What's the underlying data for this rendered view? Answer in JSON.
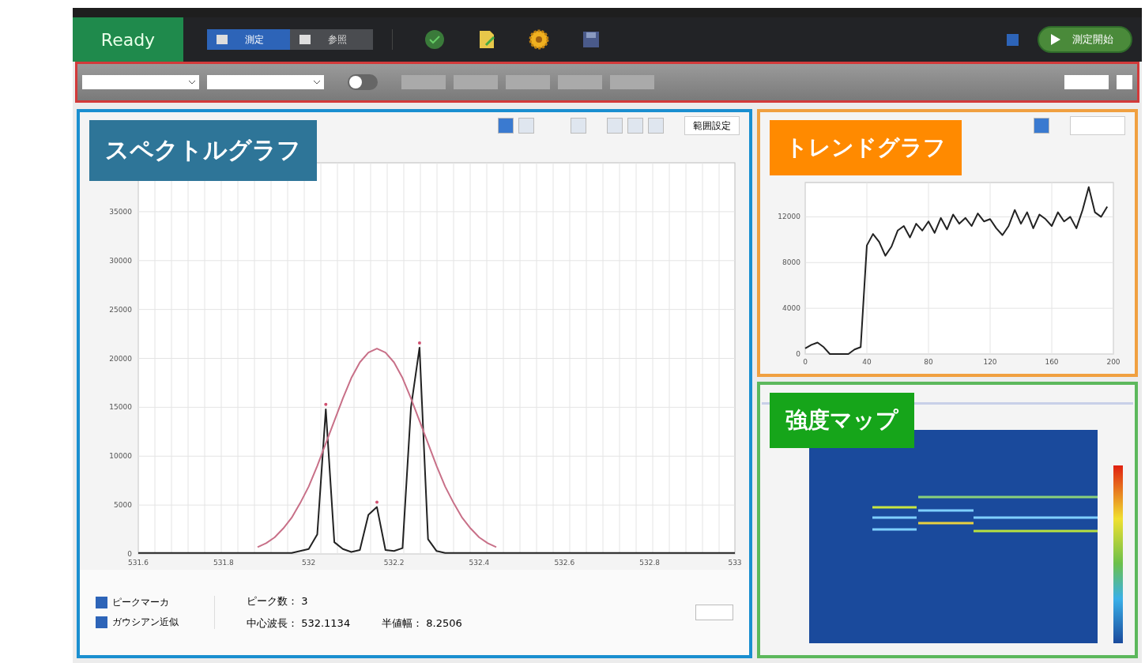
{
  "status": "Ready",
  "mode_tabs": [
    {
      "label": "測定",
      "selected": true
    },
    {
      "label": "参照",
      "selected": false
    }
  ],
  "auto_save": {
    "checked": true
  },
  "start_button": "測定開始",
  "display_toggle": {
    "on": false
  },
  "overlays": [
    {
      "label": "スペクトルグラフ",
      "color": "#2e7598"
    },
    {
      "label": "トレンドグラフ",
      "color": "#ff8a00"
    },
    {
      "label": "強度マップ",
      "color": "#16a51a"
    }
  ],
  "spectrum": {
    "range_button": "範囲設定",
    "chart_data": {
      "type": "line",
      "grid": true,
      "xlim": [
        531.6,
        533
      ],
      "ylim": [
        0,
        40000
      ],
      "xticks": [
        531.6,
        531.8,
        532,
        532.2,
        532.4,
        532.6,
        532.8,
        533
      ],
      "yticks": [
        35000,
        30000,
        25000,
        20000,
        15000,
        10000,
        5000,
        0
      ],
      "x": [
        531.6,
        531.62,
        531.64,
        531.66,
        531.68,
        531.7,
        531.72,
        531.74,
        531.76,
        531.78,
        531.8,
        531.82,
        531.84,
        531.86,
        531.88,
        531.9,
        531.92,
        531.94,
        531.96,
        531.98,
        532,
        532.02,
        532.04,
        532.06,
        532.08,
        532.1,
        532.12,
        532.14,
        532.16,
        532.18,
        532.2,
        532.22,
        532.24,
        532.26,
        532.28,
        532.3,
        532.32,
        532.34,
        532.36,
        532.38,
        532.4,
        532.42,
        532.44,
        532.46,
        532.48,
        532.5,
        532.52,
        532.54,
        532.56,
        532.58,
        532.6,
        532.62,
        532.64,
        532.66,
        532.68,
        532.7,
        532.72,
        532.74,
        532.76,
        532.78,
        532.8,
        532.82,
        532.84,
        532.86,
        532.88,
        532.9,
        532.92,
        532.94,
        532.96,
        532.98,
        533
      ],
      "series": [
        {
          "color": "#222222",
          "values": [
            100,
            100,
            100,
            100,
            100,
            100,
            100,
            100,
            100,
            100,
            100,
            100,
            100,
            100,
            100,
            100,
            100,
            100,
            100,
            300,
            500,
            2000,
            14800,
            1200,
            500,
            200,
            400,
            4000,
            4800,
            400,
            300,
            600,
            15000,
            21100,
            1500,
            300,
            100,
            100,
            100,
            100,
            100,
            100,
            100,
            100,
            100,
            100,
            100,
            100,
            100,
            100,
            100,
            100,
            100,
            100,
            100,
            100,
            100,
            100,
            100,
            100,
            100,
            100,
            100,
            100,
            100,
            100,
            100,
            100,
            100,
            100,
            100
          ]
        },
        {
          "color": "#c87088",
          "values": [
            null,
            null,
            null,
            null,
            null,
            null,
            null,
            null,
            null,
            null,
            null,
            null,
            null,
            null,
            700,
            1100,
            1700,
            2600,
            3700,
            5200,
            6900,
            9000,
            11300,
            13600,
            15900,
            18000,
            19600,
            20600,
            21000,
            20600,
            19600,
            18000,
            15900,
            13600,
            11300,
            9000,
            6900,
            5200,
            3700,
            2600,
            1700,
            1100,
            700,
            null,
            null,
            null,
            null,
            null,
            null,
            null,
            null,
            null,
            null,
            null,
            null,
            null,
            null,
            null,
            null,
            null,
            null,
            null,
            null,
            null,
            null,
            null,
            null,
            null,
            null,
            null,
            null
          ]
        }
      ]
    },
    "options": [
      {
        "label": "ピークマーカ",
        "checked": true
      },
      {
        "label": "ガウシアン近似",
        "checked": true
      }
    ],
    "peak_count": "ピーク数： 3",
    "center": "中心波長： 532.1134",
    "fwhm": "半値幅： 8.2506"
  },
  "trend": {
    "chart_data": {
      "type": "line",
      "grid": true,
      "xlim": [
        0,
        200
      ],
      "ylim": [
        0,
        15000
      ],
      "xticks": [
        0,
        40,
        80,
        120,
        160,
        200
      ],
      "yticks": [
        12000,
        8000,
        4000,
        0
      ],
      "x": [
        0,
        4,
        8,
        12,
        16,
        20,
        24,
        28,
        32,
        36,
        40,
        44,
        48,
        52,
        56,
        60,
        64,
        68,
        72,
        76,
        80,
        84,
        88,
        92,
        96,
        100,
        104,
        108,
        112,
        116,
        120,
        124,
        128,
        132,
        136,
        140,
        144,
        148,
        152,
        156,
        160,
        164,
        168,
        172,
        176,
        180,
        184,
        188,
        192,
        196
      ],
      "series": [
        {
          "color": "#222222",
          "values": [
            500,
            800,
            1000,
            600,
            0,
            0,
            0,
            0,
            400,
            600,
            9500,
            10500,
            9800,
            8600,
            9400,
            10800,
            11200,
            10200,
            11400,
            10800,
            11600,
            10600,
            11900,
            10900,
            12200,
            11400,
            11900,
            11200,
            12300,
            11600,
            11800,
            11000,
            10400,
            11200,
            12600,
            11400,
            12400,
            11000,
            12200,
            11800,
            11200,
            12400,
            11600,
            12000,
            11000,
            12600,
            14600,
            12400,
            12000,
            12900
          ]
        }
      ]
    }
  }
}
